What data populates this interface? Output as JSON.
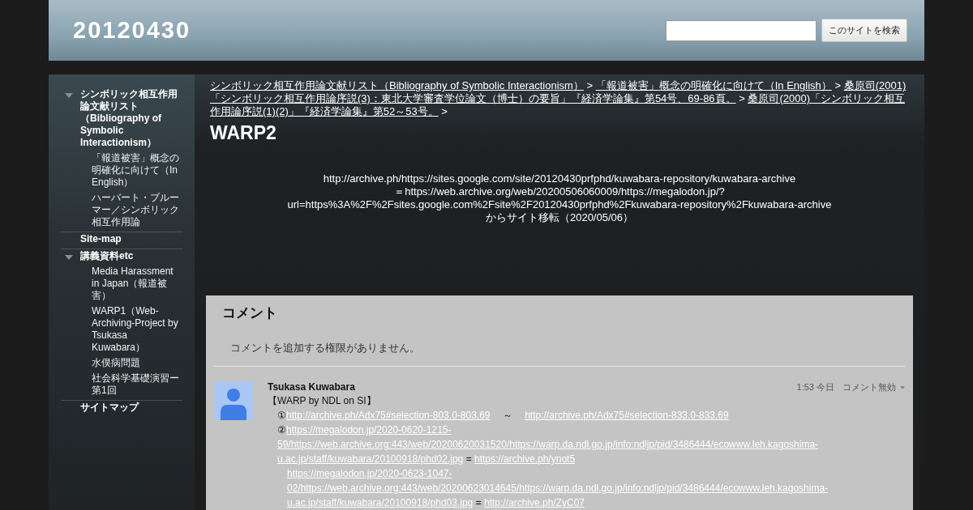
{
  "header": {
    "title": "20120430",
    "search_button": "このサイトを検索"
  },
  "sidebar": {
    "items": [
      {
        "label": "シンボリック相互作用論文献リスト（Bibliography of Symbolic Interactionism）",
        "expanded": true,
        "children": [
          {
            "label": "「報道被害」概念の明確化に向けて（In English）"
          },
          {
            "label": "ハーバート・ブルーマー／シンボリック相互作用論"
          }
        ]
      },
      {
        "label": "Site-map"
      },
      {
        "label": "講義資料etc",
        "expanded": true,
        "children": [
          {
            "label": "Media Harassment in Japan（報道被害）"
          },
          {
            "label": "WARP1（Web-Archiving-Project by Tsukasa Kuwabara）"
          },
          {
            "label": "水俣病問題"
          },
          {
            "label": "社会科学基礎演習ー第1回"
          }
        ]
      },
      {
        "label": "サイトマップ"
      }
    ]
  },
  "breadcrumbs": [
    {
      "label": "シンボリック相互作用論文献リスト（Bibliography of Symbolic Interactionism）",
      "separator": ">"
    },
    {
      "label": "「報道被害」概念の明確化に向けて（In English）",
      "separator": ">"
    },
    {
      "label": "桑原司(2001)「シンボリック相互作用論序説(3)：東北大学審査学位論文（博士）の要旨」『経済学論集』第54号、69-86頁。",
      "separator": ">"
    },
    {
      "label": "桑原司(2000)「シンボリック相互作用論序説(1)(2)」『経済学論集』第52～53号。",
      "separator": ">"
    }
  ],
  "page_title": "WARP2",
  "body_lines": [
    "http://archive.ph/https://sites.google.com/site/20120430prfphd/kuwabara-repository/kuwabara-archive",
    "＝https://web.archive.org/web/20200506060009/https://megalodon.jp/?",
    "url=https%3A%2F%2Fsites.google.com%2Fsite%2F20120430prfphd%2Fkuwabara-repository%2Fkuwabara-archive",
    "からサイト移転（2020/05/06）"
  ],
  "comments": {
    "heading": "コメント",
    "notice": "コメントを追加する権限がありません。",
    "items": [
      {
        "author": "Tsukasa Kuwabara",
        "time": "1:53 今日",
        "action": "コメント無効",
        "lines": [
          [
            {
              "kind": "text",
              "text": "【WARP by NDL on SI】"
            }
          ],
          [
            {
              "kind": "text",
              "text": "①"
            },
            {
              "kind": "link",
              "text": "http://archive.ph/Adx75#selection-803.0-803.69"
            },
            {
              "kind": "text",
              "text": "　 ～　 "
            },
            {
              "kind": "link",
              "text": "http://archive.ph/Adx75#selection-833.0-833.69"
            }
          ],
          [
            {
              "kind": "text",
              "text": "②"
            },
            {
              "kind": "link",
              "text": "https://megalodon.jp/2020-0620-1215-59/https://web.archive.org:443/web/20200620031520/https://warp.da.ndl.go.jp/info:ndljp/pid/3486444/ecowww.leh.kagoshima-u.ac.jp/staff/kuwabara/20100918/phd02.jpg"
            },
            {
              "kind": "text",
              "text": " = "
            },
            {
              "kind": "link",
              "text": "https://archive.ph/ynot5"
            }
          ],
          [
            {
              "kind": "link",
              "text": "https://megalodon.jp/2020-0623-1047-02/https://web.archive.org:443/web/20200623014645/https://warp.da.ndl.go.jp/info:ndljp/pid/3486444/ecowww.leh.kagoshima-u.ac.jp/staff/kuwabara/20100918/phd03.jpg"
            },
            {
              "kind": "text",
              "text": " = "
            },
            {
              "kind": "link",
              "text": "http://archive.ph/ZyC07"
            }
          ]
        ]
      }
    ]
  }
}
